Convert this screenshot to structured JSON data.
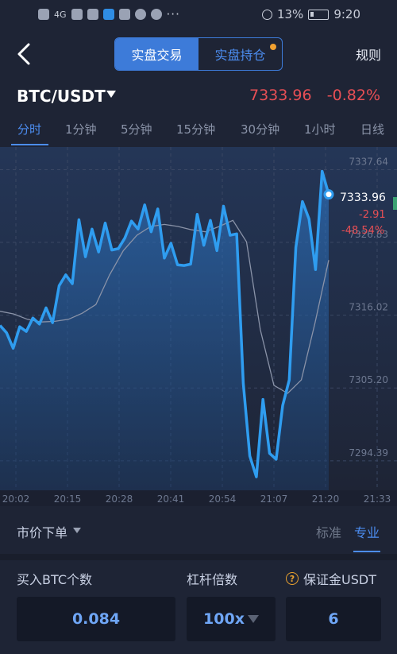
{
  "status_bar": {
    "network": "4G",
    "battery": "13%",
    "time": "9:20"
  },
  "header": {
    "tabs": [
      {
        "label": "实盘交易",
        "active": true
      },
      {
        "label": "实盘持仓",
        "active": false,
        "has_dot": true
      }
    ],
    "rules_label": "规则"
  },
  "pair": {
    "name": "BTC/USDT",
    "price": "7333.96",
    "change": "-0.82%"
  },
  "intervals": [
    "分时",
    "1分钟",
    "5分钟",
    "15分钟",
    "30分钟",
    "1小时",
    "日线"
  ],
  "chart": {
    "last_price_label": "7333.96",
    "change_abs": "-2.91",
    "change_pct": "-48.54%",
    "y_ticks": [
      "7337.64",
      "7326.83",
      "7316.02",
      "7305.20",
      "7294.39"
    ],
    "x_ticks": [
      "20:02",
      "20:15",
      "20:28",
      "20:41",
      "20:54",
      "21:07",
      "21:20",
      "21:33"
    ]
  },
  "order": {
    "type_label": "市价下单",
    "mode_standard": "标准",
    "mode_pro": "专业",
    "buy_label": "买入BTC个数",
    "leverage_label": "杠杆倍数",
    "margin_label": "保证金USDT",
    "qty_value": "0.084",
    "leverage_value": "100x",
    "margin_value": "6"
  },
  "colors": {
    "background": "#1e2435",
    "accent": "#3d7bd9",
    "down": "#e84f55",
    "line": "#2f9df0"
  },
  "chart_data": {
    "type": "line",
    "title": "",
    "x": [
      "20:02",
      "20:15",
      "20:28",
      "20:41",
      "20:54",
      "21:07",
      "21:20"
    ],
    "y_ticks": [
      7337.64,
      7326.83,
      7316.02,
      7305.2,
      7294.39
    ],
    "ylim": [
      7290.0,
      7341.0
    ],
    "series": [
      {
        "values": [
          7314.5,
          7313.4,
          7311.1,
          7314.3,
          7313.6,
          7315.6,
          7314.7,
          7317.1,
          7314.9,
          7320.4,
          7322.0,
          7320.7,
          7330.2,
          7324.7,
          7328.8,
          7325.4,
          7329.7,
          7325.7,
          7325.9,
          7327.5,
          7330.0,
          7328.8,
          7332.4,
          7328.4,
          7331.8,
          7324.5,
          7326.7,
          7323.5,
          7323.4,
          7323.6,
          7331.0,
          7326.4,
          7330.1,
          7325.6,
          7332.2,
          7327.9,
          7328.1,
          7305.9,
          7295.1,
          7292.0,
          7303.5,
          7295.5,
          7294.6,
          7302.6,
          7306.4,
          7326.1,
          7332.9,
          7330.3,
          7322.8,
          7337.4,
          7333.96
        ]
      },
      {
        "values": [
          7316.6,
          7316.2,
          7315.4,
          7315.0,
          7315.1,
          7315.4,
          7316.3,
          7317.6,
          7322.0,
          7325.6,
          7327.9,
          7329.2,
          7329.5,
          7329.2,
          7328.7,
          7328.4,
          7329.2,
          7330.1,
          7326.9,
          7313.9,
          7305.6,
          7304.4,
          7306.4,
          7314.9,
          7324.2
        ]
      }
    ]
  }
}
